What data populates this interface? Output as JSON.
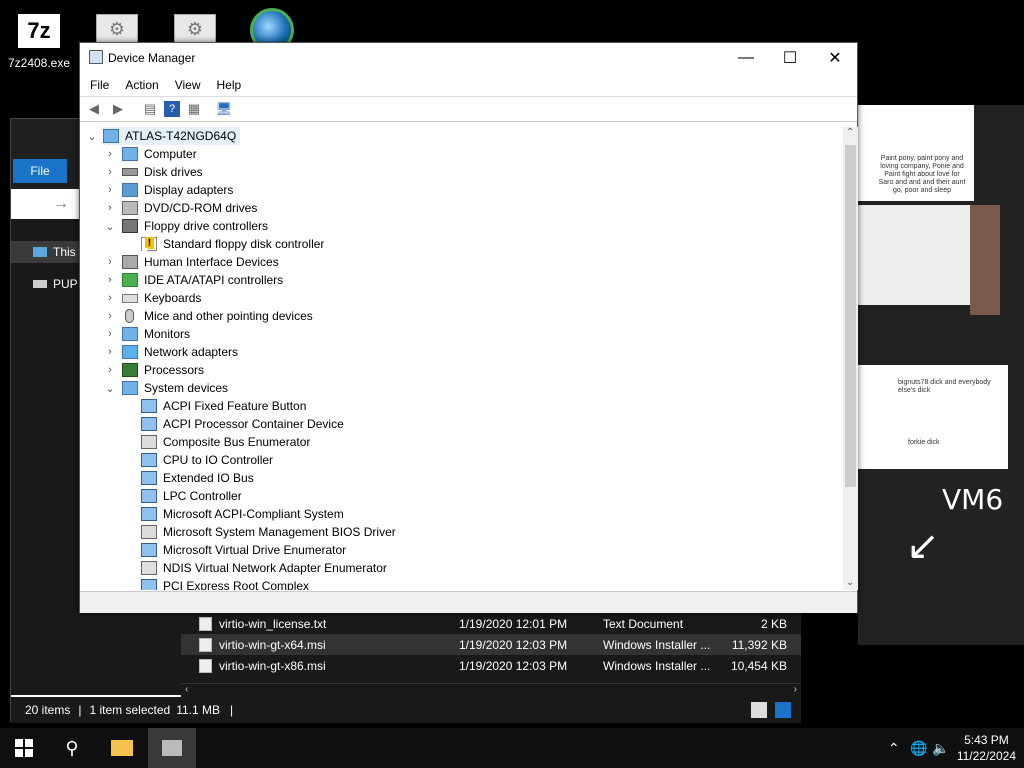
{
  "desktop": {
    "icon_7z_glyph": "7z",
    "icon_7z_label": "7z2408.exe",
    "vm_text": "VM6",
    "art_text1": "bignuts78 dick and everybody else's dick",
    "art_text2": "forkie dick",
    "art_note": "Paint pony, paint pony and loving company, Ponie and Paint fight about love for Saro and and and their aunt go, poor and sleep"
  },
  "explorer": {
    "file_tab": "File",
    "nav_items": [
      "This",
      "PUP"
    ],
    "files": [
      {
        "name": "virtio-win_license.txt",
        "date": "1/19/2020 12:01 PM",
        "type": "Text Document",
        "size": "2 KB"
      },
      {
        "name": "virtio-win-gt-x64.msi",
        "date": "1/19/2020 12:03 PM",
        "type": "Windows Installer ...",
        "size": "11,392 KB"
      },
      {
        "name": "virtio-win-gt-x86.msi",
        "date": "1/19/2020 12:03 PM",
        "type": "Windows Installer ...",
        "size": "10,454 KB"
      }
    ],
    "status_items": "20 items",
    "status_selected": "1 item selected",
    "status_size": "11.1 MB"
  },
  "device_manager": {
    "title": "Device Manager",
    "menu": [
      "File",
      "Action",
      "View",
      "Help"
    ],
    "root": "ATLAS-T42NGD64Q",
    "categories": [
      "Computer",
      "Disk drives",
      "Display adapters",
      "DVD/CD-ROM drives",
      "Floppy drive controllers",
      "Standard floppy disk controller",
      "Human Interface Devices",
      "IDE ATA/ATAPI controllers",
      "Keyboards",
      "Mice and other pointing devices",
      "Monitors",
      "Network adapters",
      "Processors",
      "System devices"
    ],
    "system_devices": [
      "ACPI Fixed Feature Button",
      "ACPI Processor Container Device",
      "Composite Bus Enumerator",
      "CPU to IO Controller",
      "Extended IO Bus",
      "LPC Controller",
      "Microsoft ACPI-Compliant System",
      "Microsoft System Management BIOS Driver",
      "Microsoft Virtual Drive Enumerator",
      "NDIS Virtual Network Adapter Enumerator",
      "PCI Express Root Complex"
    ]
  },
  "taskbar": {
    "time": "5:43 PM",
    "date": "11/22/2024"
  },
  "colors": {
    "accent": "#1a73c9",
    "taskbar": "#101010",
    "selection": "#e5f0fb"
  }
}
